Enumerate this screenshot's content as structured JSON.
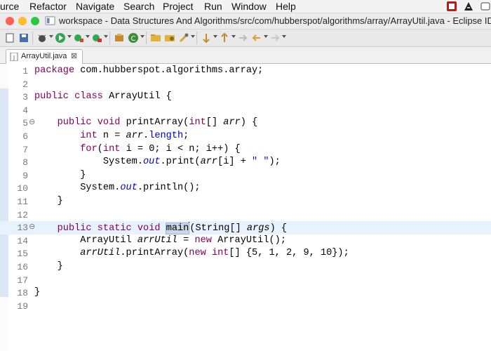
{
  "menubar": {
    "items": [
      "urce",
      "Refactor",
      "Navigate",
      "Search",
      "Project",
      "Run",
      "Window",
      "Help"
    ]
  },
  "window": {
    "title": "workspace - Data Structures And Algorithms/src/com/hubberspot/algorithms/array/ArrayUtil.java - Eclipse IDE"
  },
  "editor": {
    "tab_label": "ArrayUtil.java",
    "tab_close": "⊠",
    "lines": [
      {
        "n": "1",
        "text": "package com.hubberspot.algorithms.array;"
      },
      {
        "n": "2",
        "text": ""
      },
      {
        "n": "3",
        "text": "public class ArrayUtil {"
      },
      {
        "n": "4",
        "text": ""
      },
      {
        "n": "5",
        "text": "    public void printArray(int[] arr) {",
        "fold": "⊖"
      },
      {
        "n": "6",
        "text": "        int n = arr.length;"
      },
      {
        "n": "7",
        "text": "        for(int i = 0; i < n; i++) {"
      },
      {
        "n": "8",
        "text": "            System.out.print(arr[i] + \" \");"
      },
      {
        "n": "9",
        "text": "        }"
      },
      {
        "n": "10",
        "text": "        System.out.println();"
      },
      {
        "n": "11",
        "text": "    }"
      },
      {
        "n": "12",
        "text": ""
      },
      {
        "n": "13",
        "text": "    public static void main(String[] args) {",
        "fold": "⊖"
      },
      {
        "n": "14",
        "text": "        ArrayUtil arrUtil = new ArrayUtil();"
      },
      {
        "n": "15",
        "text": "        arrUtil.printArray(new int[] {5, 1, 2, 9, 10});"
      },
      {
        "n": "16",
        "text": "    }"
      },
      {
        "n": "17",
        "text": ""
      },
      {
        "n": "18",
        "text": "}"
      },
      {
        "n": "19",
        "text": ""
      }
    ]
  },
  "colors": {
    "keyword": "#7f0055",
    "field": "#0000c0",
    "string": "#2a00ff",
    "current_line": "#e8f2fe"
  },
  "icons": [
    "apple-logo-icon",
    "eclipse-app-icon",
    "new-icon",
    "save-icon",
    "debug-icon",
    "run-icon",
    "coverage-icon",
    "external-tools-icon",
    "new-class-icon",
    "open-type-icon",
    "search-icon",
    "back-icon",
    "forward-icon"
  ]
}
